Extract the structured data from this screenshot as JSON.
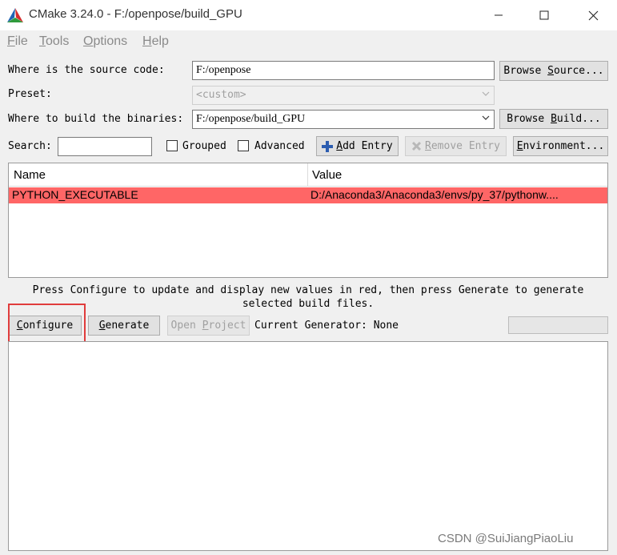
{
  "window": {
    "title": "CMake 3.24.0 - F:/openpose/build_GPU",
    "logo_icon": "cmake-triangle-icon",
    "controls": [
      "minimize-icon",
      "maximize-icon",
      "close-icon"
    ]
  },
  "menu": {
    "file": {
      "accel": "F",
      "rest": "ile"
    },
    "tools": {
      "accel": "T",
      "rest": "ools"
    },
    "options": {
      "accel": "O",
      "rest": "ptions"
    },
    "help": {
      "accel": "H",
      "rest": "elp"
    }
  },
  "source": {
    "label": "Where is the source code:",
    "value": "F:/openpose",
    "browse_prefix": "Browse ",
    "browse_accel": "S",
    "browse_rest": "ource..."
  },
  "preset": {
    "label": "Preset:",
    "value": "<custom>"
  },
  "build": {
    "label": "Where to build the binaries:",
    "value": "F:/openpose/build_GPU",
    "browse_prefix": "Browse ",
    "browse_accel": "B",
    "browse_rest": "uild..."
  },
  "search": {
    "label": "Search:",
    "value": "",
    "grouped_label": "Grouped",
    "advanced_label": "Advanced",
    "add_entry_accel": "A",
    "add_entry_rest": "dd Entry",
    "remove_entry_accel": "R",
    "remove_entry_rest": "emove Entry",
    "environment_accel": "E",
    "environment_rest": "nvironment..."
  },
  "table": {
    "columns": [
      "Name",
      "Value"
    ],
    "rows": [
      {
        "name": "PYTHON_EXECUTABLE",
        "value": "D:/Anaconda3/Anaconda3/envs/py_37/pythonw...."
      }
    ],
    "new_row_color": "#ff6666"
  },
  "hint": "Press Configure to update and display new values in red, then press Generate to generate selected build files.",
  "actions": {
    "configure_accel": "C",
    "configure_rest": "onfigure",
    "generate_accel": "G",
    "generate_rest": "enerate",
    "open_project_prefix": "Open ",
    "open_project_accel": "P",
    "open_project_rest": "roject",
    "generator_label": "Current Generator: None",
    "progress": 0
  },
  "highlight_color": "#e03c3c",
  "watermark": "CSDN @SuiJiangPiaoLiu"
}
